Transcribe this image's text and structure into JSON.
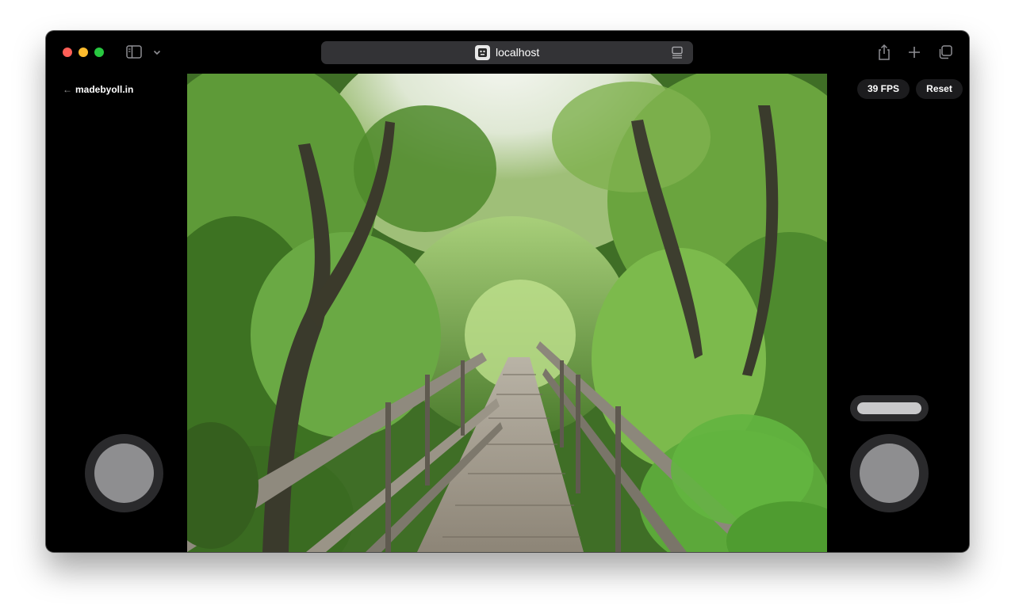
{
  "browser": {
    "url": "localhost",
    "icons": [
      "sidebar-icon",
      "chevron-down-icon",
      "site-icon",
      "reader-icon",
      "share-icon",
      "plus-icon",
      "tabs-icon"
    ]
  },
  "app": {
    "back_arrow": "←",
    "back_label": "madebyoll.in",
    "fps_label": "39 FPS",
    "reset_label": "Reset"
  },
  "scene": {
    "description_icon": "boardwalk-forest-scene"
  },
  "controls": {
    "left_joystick": "joystick",
    "right_joystick": "joystick",
    "jump": "button"
  }
}
